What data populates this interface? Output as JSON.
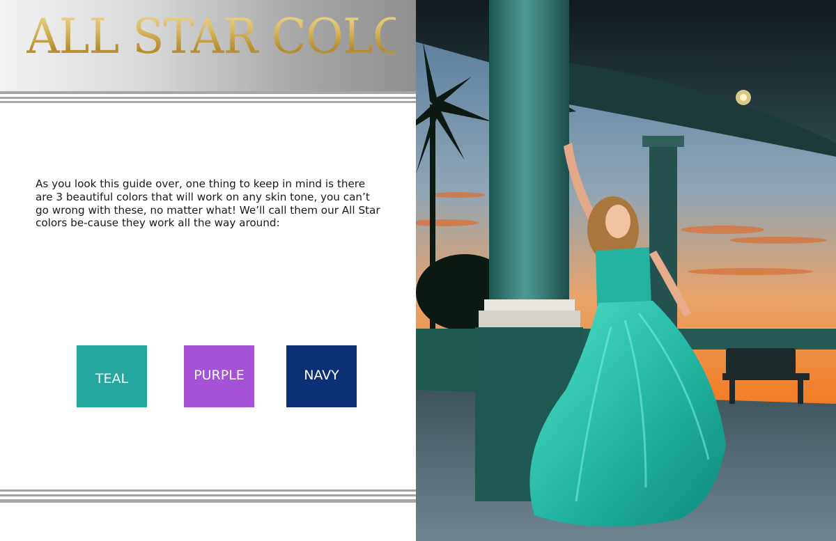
{
  "header": {
    "title": "ALL STAR COLORS"
  },
  "body": {
    "intro": "As you look this guide over, one thing to keep in mind is there are 3 beautiful colors that will work on any skin tone, you can’t go wrong with these, no matter what! We’ll call them our All Star colors be-cause they work all the way around:"
  },
  "swatches": [
    {
      "label": "TEAL",
      "color": "#26a79d"
    },
    {
      "label": "PURPLE",
      "color": "#a552d6"
    },
    {
      "label": "NAVY",
      "color": "#0c3076"
    }
  ],
  "photo": {
    "subject": "woman in teal ball gown beside a column at sunset",
    "colors": {
      "sky_top": "#5d86a8",
      "sky_glow": "#f08a2e",
      "dress": "#2ec4b0",
      "column": "#3c8a83"
    }
  }
}
